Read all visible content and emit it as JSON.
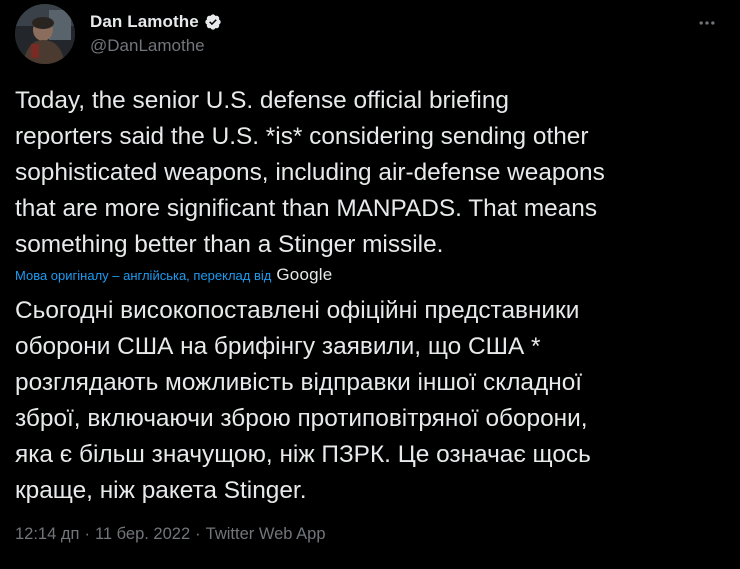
{
  "author": {
    "display_name": "Dan Lamothe",
    "handle": "@DanLamothe",
    "verified": true,
    "avatar_icon": "user-avatar"
  },
  "tweet": {
    "original_text": "Today, the senior U.S. defense official briefing\nreporters said the U.S. *is* considering sending other\nsophisticated weapons, including air-defense weapons\nthat are more significant than MANPADS. That means\nsomething better than a Stinger missile.",
    "translation_note": "Мова оригіналу – англійська, переклад від",
    "translation_provider": "Google",
    "translated_text": "Сьогодні високопоставлені офіційні представники\nоборони США на брифінгу заявили, що США *\nрозглядають можливість відправки іншої складної\nзброї, включаючи зброю протиповітряної оборони,\nяка є більш значущою, ніж ПЗРК. Це означає щось\nкраще, ніж ракета Stinger.",
    "time": "12:14 дп",
    "separator": "·",
    "date": "11 бер. 2022",
    "source_app": "Twitter Web App"
  },
  "colors": {
    "background": "#000000",
    "text": "#e7e9ea",
    "muted": "#71767b",
    "accent": "#1d9bf0"
  },
  "icons": {
    "verified": "verified-badge-icon",
    "more": "more-options-icon"
  }
}
